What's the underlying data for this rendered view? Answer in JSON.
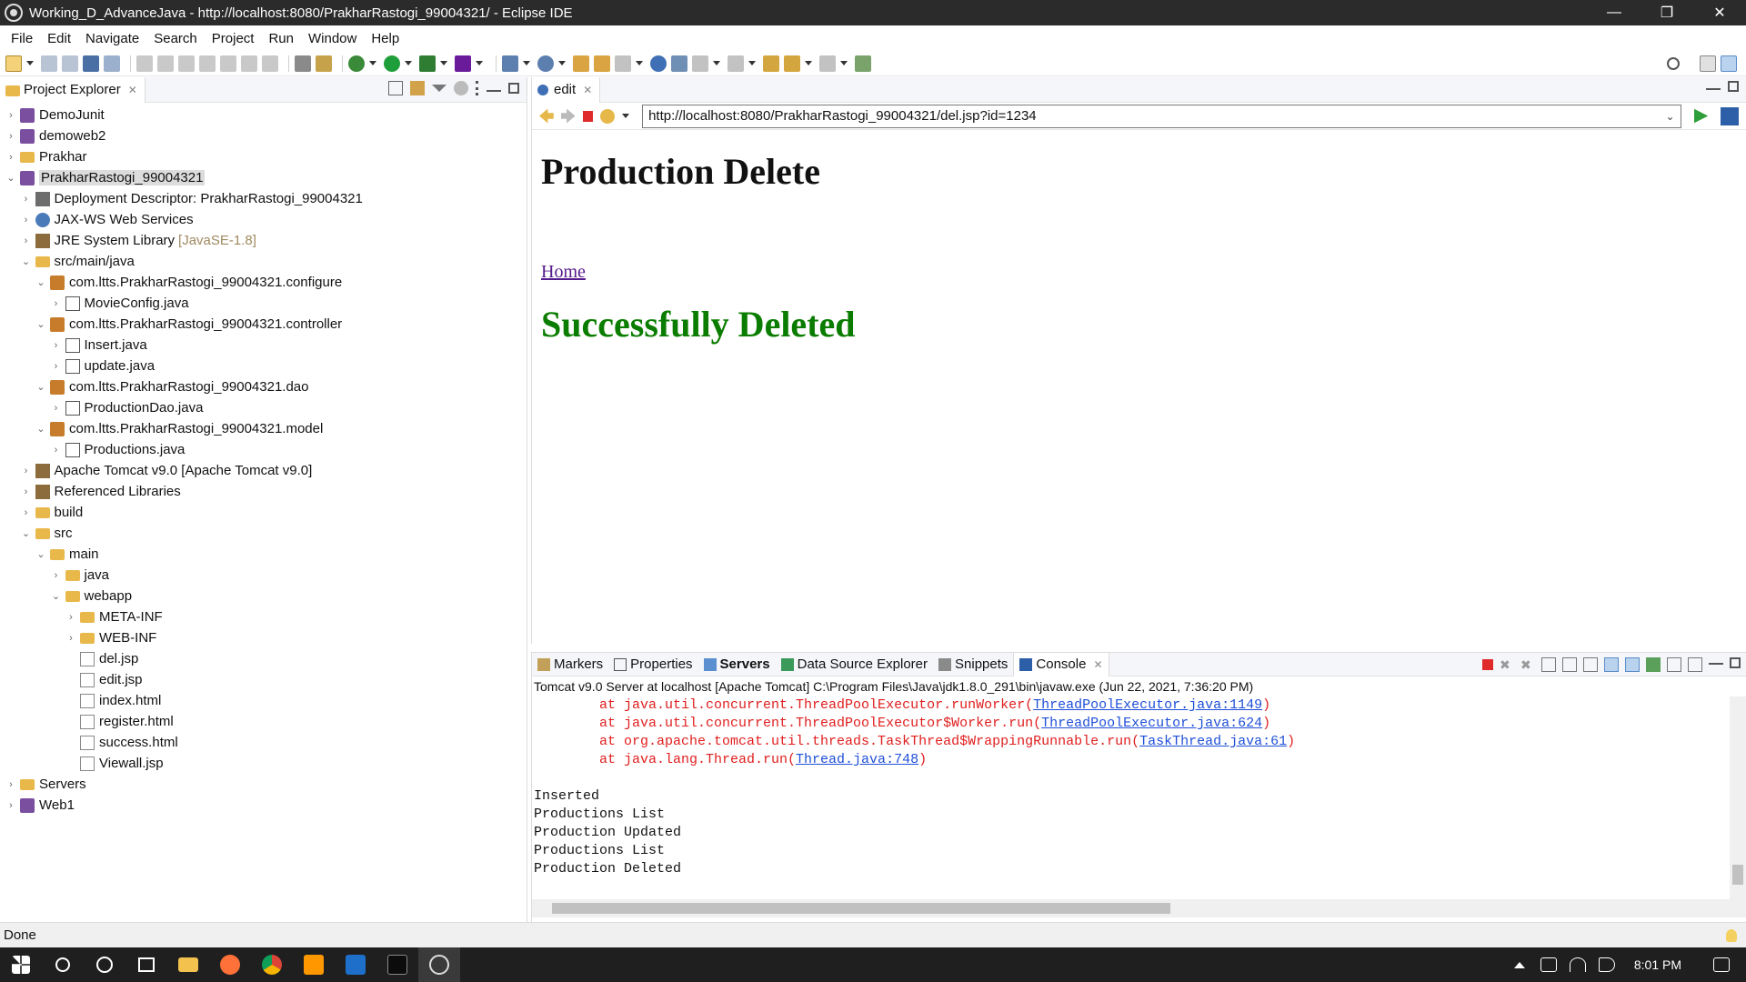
{
  "window": {
    "title": "Working_D_AdvanceJava - http://localhost:8080/PrakharRastogi_99004321/ - Eclipse IDE",
    "controls": [
      "—",
      "❐",
      "✕"
    ]
  },
  "menu": [
    "File",
    "Edit",
    "Navigate",
    "Search",
    "Project",
    "Run",
    "Window",
    "Help"
  ],
  "explorer": {
    "tab_label": "Project Explorer",
    "tree": [
      {
        "label": "DemoJunit",
        "depth": 0,
        "arrow": "›",
        "icon": "project"
      },
      {
        "label": "demoweb2",
        "depth": 0,
        "arrow": "›",
        "icon": "project"
      },
      {
        "label": "Prakhar",
        "depth": 0,
        "arrow": "›",
        "icon": "folder"
      },
      {
        "label": "PrakharRastogi_99004321",
        "depth": 0,
        "arrow": "⌄",
        "icon": "project",
        "selected": true
      },
      {
        "label": "Deployment Descriptor: PrakharRastogi_99004321",
        "depth": 1,
        "arrow": "›",
        "icon": "dd"
      },
      {
        "label": "JAX-WS Web Services",
        "depth": 1,
        "arrow": "›",
        "icon": "ws"
      },
      {
        "label": "JRE System Library",
        "suffix": "[JavaSE-1.8]",
        "depth": 1,
        "arrow": "›",
        "icon": "lib"
      },
      {
        "label": "src/main/java",
        "depth": 1,
        "arrow": "⌄",
        "icon": "folder"
      },
      {
        "label": "com.ltts.PrakharRastogi_99004321.configure",
        "depth": 2,
        "arrow": "⌄",
        "icon": "pkg"
      },
      {
        "label": "MovieConfig.java",
        "depth": 3,
        "arrow": "›",
        "icon": "java"
      },
      {
        "label": "com.ltts.PrakharRastogi_99004321.controller",
        "depth": 2,
        "arrow": "⌄",
        "icon": "pkg"
      },
      {
        "label": "Insert.java",
        "depth": 3,
        "arrow": "›",
        "icon": "java"
      },
      {
        "label": "update.java",
        "depth": 3,
        "arrow": "›",
        "icon": "java"
      },
      {
        "label": "com.ltts.PrakharRastogi_99004321.dao",
        "depth": 2,
        "arrow": "⌄",
        "icon": "pkg"
      },
      {
        "label": "ProductionDao.java",
        "depth": 3,
        "arrow": "›",
        "icon": "java"
      },
      {
        "label": "com.ltts.PrakharRastogi_99004321.model",
        "depth": 2,
        "arrow": "⌄",
        "icon": "pkg"
      },
      {
        "label": "Productions.java",
        "depth": 3,
        "arrow": "›",
        "icon": "java"
      },
      {
        "label": "Apache Tomcat v9.0 [Apache Tomcat v9.0]",
        "depth": 1,
        "arrow": "›",
        "icon": "lib"
      },
      {
        "label": "Referenced Libraries",
        "depth": 1,
        "arrow": "›",
        "icon": "lib"
      },
      {
        "label": "build",
        "depth": 1,
        "arrow": "›",
        "icon": "folder"
      },
      {
        "label": "src",
        "depth": 1,
        "arrow": "⌄",
        "icon": "folder"
      },
      {
        "label": "main",
        "depth": 2,
        "arrow": "⌄",
        "icon": "folder"
      },
      {
        "label": "java",
        "depth": 3,
        "arrow": "›",
        "icon": "folder"
      },
      {
        "label": "webapp",
        "depth": 3,
        "arrow": "⌄",
        "icon": "folder"
      },
      {
        "label": "META-INF",
        "depth": 4,
        "arrow": "›",
        "icon": "folder"
      },
      {
        "label": "WEB-INF",
        "depth": 4,
        "arrow": "›",
        "icon": "folder"
      },
      {
        "label": "del.jsp",
        "depth": 4,
        "arrow": "",
        "icon": "file"
      },
      {
        "label": "edit.jsp",
        "depth": 4,
        "arrow": "",
        "icon": "file"
      },
      {
        "label": "index.html",
        "depth": 4,
        "arrow": "",
        "icon": "file"
      },
      {
        "label": "register.html",
        "depth": 4,
        "arrow": "",
        "icon": "file"
      },
      {
        "label": "success.html",
        "depth": 4,
        "arrow": "",
        "icon": "file"
      },
      {
        "label": "Viewall.jsp",
        "depth": 4,
        "arrow": "",
        "icon": "file"
      },
      {
        "label": "Servers",
        "depth": 0,
        "arrow": "›",
        "icon": "folder"
      },
      {
        "label": "Web1",
        "depth": 0,
        "arrow": "›",
        "icon": "project"
      }
    ]
  },
  "editor": {
    "tab_label": "edit",
    "url": "http://localhost:8080/PrakharRastogi_99004321/del.jsp?id=1234",
    "page": {
      "heading": "Production Delete",
      "home_link": "Home",
      "message": "Successfully Deleted"
    }
  },
  "bottom": {
    "tabs": [
      {
        "label": "Markers",
        "active": false,
        "bold": false
      },
      {
        "label": "Properties",
        "active": false,
        "bold": false
      },
      {
        "label": "Servers",
        "active": false,
        "bold": true
      },
      {
        "label": "Data Source Explorer",
        "active": false,
        "bold": false
      },
      {
        "label": "Snippets",
        "active": false,
        "bold": false
      },
      {
        "label": "Console",
        "active": true,
        "bold": false
      }
    ],
    "console_title": "Tomcat v9.0 Server at localhost [Apache Tomcat] C:\\Program Files\\Java\\jdk1.8.0_291\\bin\\javaw.exe  (Jun 22, 2021, 7:36:20 PM)",
    "error_lines": [
      {
        "prefix": "        at java.util.concurrent.ThreadPoolExecutor.runWorker(",
        "link": "ThreadPoolExecutor.java:1149",
        "suffix": ")"
      },
      {
        "prefix": "        at java.util.concurrent.ThreadPoolExecutor$Worker.run(",
        "link": "ThreadPoolExecutor.java:624",
        "suffix": ")"
      },
      {
        "prefix": "        at org.apache.tomcat.util.threads.TaskThread$WrappingRunnable.run(",
        "link": "TaskThread.java:61",
        "suffix": ")"
      },
      {
        "prefix": "        at java.lang.Thread.run(",
        "link": "Thread.java:748",
        "suffix": ")"
      }
    ],
    "output_lines": [
      "",
      "Inserted",
      "Productions List",
      "Production Updated",
      "Productions List",
      "Production Deleted"
    ]
  },
  "status": {
    "text": "Done"
  },
  "taskbar": {
    "time": "8:01 PM",
    "apps": [
      "start-icon",
      "search-icon",
      "cortana-icon",
      "task-view-icon",
      "file-explorer-icon",
      "firefox-icon",
      "chrome-icon",
      "sublime-icon",
      "photos-icon",
      "terminal-icon",
      "eclipse-icon"
    ]
  },
  "colors": {
    "success_green": "#0a7d00",
    "error_red": "#e01e1e",
    "link_blue": "#1f4fd8",
    "titlebar": "#2b2b2b",
    "taskbar": "#1f1f1f"
  }
}
